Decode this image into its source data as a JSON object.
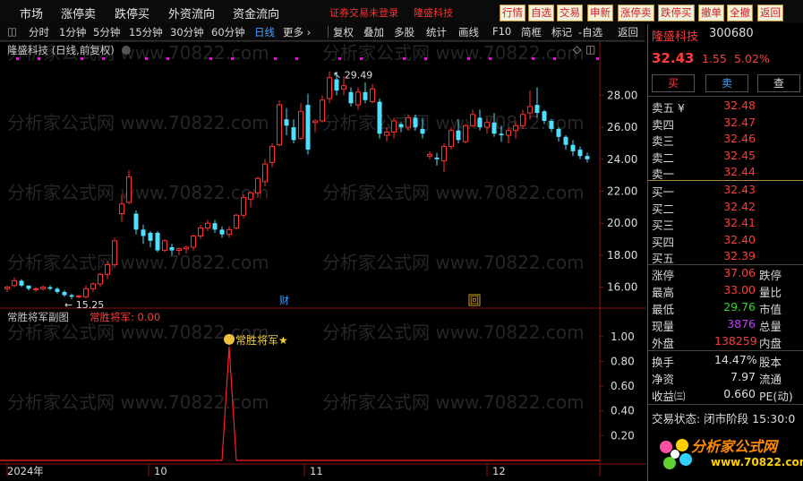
{
  "menu": [
    "市场",
    "涨停卖",
    "跌停买",
    "外资流向",
    "资金流向"
  ],
  "status_msg": "证券交易未登录",
  "stock_title": "隆盛科技",
  "top_buttons": [
    "行情",
    "自选",
    "交易",
    "申新",
    "涨停卖",
    "跌停买",
    "撤单",
    "全撤",
    "返回"
  ],
  "periods": [
    "分时",
    "1分钟",
    "5分钟",
    "15分钟",
    "30分钟",
    "60分钟",
    "日线",
    "更多 ›"
  ],
  "tools": [
    "复权",
    "叠加",
    "多股",
    "统计",
    "画线",
    "F10",
    "简框",
    "标记",
    "-自选",
    "返回"
  ],
  "main_label": "隆盛科技 (日线,前复权)",
  "price_ticks": [
    "28.00",
    "26.00",
    "24.00",
    "22.00",
    "20.00",
    "18.00",
    "16.00"
  ],
  "high_marker": "29.49",
  "low_marker": "15.25",
  "event_labels": [
    "财",
    "回"
  ],
  "sub_label": "常胜将军副图",
  "sub_value": "常胜将军: 0.00",
  "sub_ticks": [
    "1.00",
    "0.80",
    "0.60",
    "0.40",
    "0.20"
  ],
  "signal_text": "常胜将军★",
  "x_dates": [
    "2024年",
    "10",
    "11",
    "12"
  ],
  "watermark": "分析家公式网 www.70822.com",
  "logo_text": "分析家公式网",
  "logo_url": "www.70822.com",
  "side": {
    "name": "隆盛科技",
    "code": "300680",
    "price": "32.43",
    "change": "1.55",
    "pct": "5.02%",
    "buy_btn": "买",
    "sell_btn": "卖",
    "query_btn": "查",
    "asks": [
      {
        "label": "卖五 ¥",
        "price": "32.48"
      },
      {
        "label": "卖四",
        "price": "32.47"
      },
      {
        "label": "卖三",
        "price": "32.46"
      },
      {
        "label": "卖二",
        "price": "32.45"
      },
      {
        "label": "卖一",
        "price": "32.44"
      }
    ],
    "bids": [
      {
        "label": "买一",
        "price": "32.43"
      },
      {
        "label": "买二",
        "price": "32.42"
      },
      {
        "label": "买三",
        "price": "32.41"
      },
      {
        "label": "买四",
        "price": "32.40"
      },
      {
        "label": "买五",
        "price": "32.39"
      }
    ],
    "stats": [
      {
        "l1": "涨停",
        "v": "37.06",
        "c": "#ff3b3b",
        "l2": "跌停"
      },
      {
        "l1": "最高",
        "v": "33.00",
        "c": "#ff3b3b",
        "l2": "量比"
      },
      {
        "l1": "最低",
        "v": "29.76",
        "c": "#2fd82f",
        "l2": "市值"
      },
      {
        "l1": "现量",
        "v": "3876",
        "c": "#c040ff",
        "l2": "总量"
      },
      {
        "l1": "外盘",
        "v": "138259",
        "c": "#ff3b3b",
        "l2": "内盘"
      }
    ],
    "stats2": [
      {
        "l1": "换手",
        "v": "14.47%",
        "l2": "股本"
      },
      {
        "l1": "净资",
        "v": "7.97",
        "l2": "流通"
      },
      {
        "l1": "收益㈢",
        "v": "0.660",
        "l2": "PE(动)"
      }
    ],
    "trade_state": "交易状态: 闭市阶段 15:30:0"
  },
  "chart_data": {
    "type": "candlestick",
    "ylim": [
      14.8,
      30.6
    ],
    "up_color": "#ff3030",
    "down_color": "#4fe0ff",
    "candles": [
      [
        15.9,
        16.1,
        15.7,
        16.0
      ],
      [
        16.1,
        16.6,
        16.0,
        16.4
      ],
      [
        16.4,
        16.5,
        16.0,
        16.1
      ],
      [
        16.1,
        16.1,
        15.8,
        15.9
      ],
      [
        15.9,
        16.0,
        15.7,
        15.9
      ],
      [
        15.9,
        16.1,
        15.8,
        16.0
      ],
      [
        16.0,
        16.1,
        15.8,
        15.9
      ],
      [
        15.9,
        16.0,
        15.6,
        15.7
      ],
      [
        15.7,
        15.8,
        15.4,
        15.5
      ],
      [
        15.5,
        15.6,
        15.25,
        15.4
      ],
      [
        15.4,
        15.5,
        15.3,
        15.45
      ],
      [
        15.4,
        16.1,
        15.3,
        15.9
      ],
      [
        15.9,
        16.3,
        15.7,
        16.2
      ],
      [
        16.2,
        16.9,
        16.0,
        16.8
      ],
      [
        16.8,
        17.6,
        16.5,
        17.4
      ],
      [
        17.4,
        19.1,
        17.2,
        18.9
      ],
      [
        20.6,
        21.8,
        20.1,
        21.2
      ],
      [
        21.3,
        23.3,
        21.2,
        22.9
      ],
      [
        20.6,
        20.8,
        19.3,
        19.6
      ],
      [
        19.6,
        19.9,
        18.7,
        19.2
      ],
      [
        19.4,
        19.5,
        18.5,
        18.9
      ],
      [
        19.4,
        19.5,
        18.2,
        18.3
      ],
      [
        18.3,
        19.0,
        18.2,
        18.9
      ],
      [
        18.5,
        18.7,
        18.0,
        18.3
      ],
      [
        18.3,
        18.5,
        18.0,
        18.4
      ],
      [
        18.4,
        18.6,
        18.1,
        18.5
      ],
      [
        18.5,
        19.3,
        18.3,
        19.2
      ],
      [
        19.2,
        19.9,
        19.0,
        19.7
      ],
      [
        19.7,
        20.2,
        19.5,
        20.0
      ],
      [
        20.0,
        20.2,
        19.4,
        19.6
      ],
      [
        19.6,
        19.8,
        19.1,
        19.3
      ],
      [
        19.3,
        19.8,
        19.1,
        19.6
      ],
      [
        19.7,
        20.6,
        19.6,
        20.5
      ],
      [
        20.5,
        21.8,
        20.3,
        21.6
      ],
      [
        21.5,
        22.0,
        21.0,
        21.9
      ],
      [
        21.9,
        22.9,
        21.6,
        22.8
      ],
      [
        22.6,
        24.0,
        22.3,
        23.7
      ],
      [
        23.8,
        25.0,
        23.5,
        24.8
      ],
      [
        24.9,
        27.7,
        24.8,
        27.4
      ],
      [
        26.5,
        27.2,
        25.5,
        26.1
      ],
      [
        26.0,
        26.5,
        25.0,
        25.2
      ],
      [
        25.3,
        27.5,
        25.2,
        27.0
      ],
      [
        27.4,
        28.1,
        24.3,
        24.6
      ],
      [
        26.3,
        26.5,
        25.7,
        26.4
      ],
      [
        26.4,
        28.0,
        26.3,
        27.7
      ],
      [
        27.8,
        29.49,
        27.5,
        29.1
      ],
      [
        29.0,
        29.5,
        28.0,
        28.3
      ],
      [
        28.4,
        29.2,
        28.0,
        28.6
      ],
      [
        28.2,
        28.5,
        27.3,
        27.5
      ],
      [
        27.4,
        28.5,
        27.1,
        28.2
      ],
      [
        28.2,
        28.8,
        27.5,
        27.7
      ],
      [
        27.6,
        28.7,
        27.5,
        28.4
      ],
      [
        27.6,
        27.8,
        25.3,
        25.6
      ],
      [
        25.5,
        26.0,
        25.1,
        25.7
      ],
      [
        25.7,
        26.6,
        25.3,
        26.4
      ],
      [
        26.2,
        26.3,
        25.7,
        26.0
      ],
      [
        26.0,
        26.8,
        25.8,
        26.6
      ],
      [
        26.6,
        26.8,
        25.8,
        26.0
      ],
      [
        25.9,
        26.6,
        25.3,
        25.6
      ],
      [
        24.2,
        24.5,
        24.0,
        24.3
      ],
      [
        24.1,
        24.4,
        23.6,
        24.0
      ],
      [
        23.9,
        25.0,
        23.2,
        24.8
      ],
      [
        24.8,
        26.0,
        24.6,
        25.8
      ],
      [
        25.8,
        26.5,
        25.0,
        25.2
      ],
      [
        25.1,
        26.2,
        25.0,
        26.1
      ],
      [
        26.1,
        27.1,
        26.0,
        26.8
      ],
      [
        26.6,
        27.1,
        25.8,
        26.0
      ],
      [
        26.0,
        26.6,
        25.6,
        26.3
      ],
      [
        26.3,
        26.9,
        25.4,
        25.6
      ],
      [
        25.6,
        26.1,
        25.1,
        25.5
      ],
      [
        25.5,
        26.0,
        25.0,
        25.8
      ],
      [
        25.8,
        26.4,
        25.3,
        26.1
      ],
      [
        26.1,
        27.1,
        25.9,
        26.8
      ],
      [
        26.9,
        28.3,
        26.5,
        27.3
      ],
      [
        27.4,
        28.5,
        26.6,
        26.9
      ],
      [
        27.0,
        27.1,
        26.2,
        26.4
      ],
      [
        26.4,
        26.5,
        25.7,
        25.9
      ],
      [
        25.9,
        26.0,
        25.1,
        25.4
      ],
      [
        25.4,
        25.5,
        24.6,
        24.9
      ],
      [
        24.9,
        25.2,
        24.2,
        24.5
      ],
      [
        24.6,
        24.8,
        24.0,
        24.2
      ],
      [
        24.2,
        24.4,
        23.8,
        24.0
      ]
    ],
    "signal_series": {
      "name": "常胜将军",
      "peak_index": 31,
      "peak_value": 0.92,
      "ylim": [
        0,
        1.1
      ]
    }
  }
}
